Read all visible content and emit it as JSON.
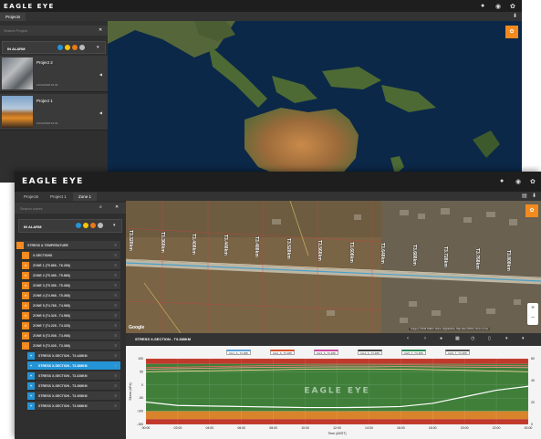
{
  "app": {
    "brand": "EAGLE EYE",
    "accent": "#f28a1e",
    "selected_color": "#2494d6"
  },
  "window1": {
    "tabs": [
      "Projects"
    ],
    "search_placeholder": "Search Project",
    "alarm_label": "IN ALARM",
    "alarm_badges": [
      {
        "color": "#2494d6"
      },
      {
        "color": "#f2c40c"
      },
      {
        "color": "#e8781c"
      },
      {
        "color": "#bbbbbb"
      }
    ],
    "projects": [
      {
        "name": "Project 2",
        "date": "10/12/2018 10:30"
      },
      {
        "name": "Project 1",
        "date": "10/12/2018 10:30"
      }
    ]
  },
  "window2": {
    "tabs": [
      "Projects",
      "Project 1",
      "Zone 1"
    ],
    "search_placeholder": "Search zones",
    "alarm_label": "IN ALARM",
    "tree": [
      {
        "label": "STRESS & TEMPERATURE",
        "level": 0,
        "icon": "-",
        "kind": "orange"
      },
      {
        "label": "X-SECTIONS",
        "level": 1,
        "icon": "-",
        "kind": "orange"
      },
      {
        "label": "ZONE 1 (T5.868 - T6.268)",
        "level": 2,
        "icon": ">",
        "kind": "orange"
      },
      {
        "label": "ZONE 2 (T5.368 - T5.868)",
        "level": 2,
        "icon": ">",
        "kind": "orange"
      },
      {
        "label": "ZONE 3 (T5.358 - T5.368)",
        "level": 2,
        "icon": ">",
        "kind": "orange"
      },
      {
        "label": "ZONE 4 (T4.968 - T5.368)",
        "level": 2,
        "icon": ">",
        "kind": "orange"
      },
      {
        "label": "ZONE 5 (T4.768 - T4.968)",
        "level": 2,
        "icon": ">",
        "kind": "orange"
      },
      {
        "label": "ZONE 6 (T4.328 - T4.568)",
        "level": 2,
        "icon": ">",
        "kind": "orange"
      },
      {
        "label": "ZONE 7 (T4.228 - T4.328)",
        "level": 2,
        "icon": ">",
        "kind": "orange"
      },
      {
        "label": "ZONE 8 (T3.008 - T4.068)",
        "level": 2,
        "icon": ">",
        "kind": "orange"
      },
      {
        "label": "ZONE 9 (T3.028 - T3.368)",
        "level": 2,
        "icon": "-",
        "kind": "orange"
      },
      {
        "label": "STRESS X-SECTION - T3.448KM",
        "level": 3,
        "icon": "+",
        "kind": "blue"
      },
      {
        "label": "STRESS X-SECTION - T3.388KM",
        "level": 3,
        "icon": "+",
        "kind": "blue",
        "selected": true
      },
      {
        "label": "STRESS X-SECTION - T3.328KM",
        "level": 3,
        "icon": "+",
        "kind": "blue"
      },
      {
        "label": "STRESS X-SECTION - T3.268KM",
        "level": 3,
        "icon": "+",
        "kind": "blue"
      },
      {
        "label": "STRESS X-SECTION - T3.208KM",
        "level": 3,
        "icon": "+",
        "kind": "blue"
      },
      {
        "label": "STRESS X-SECTION - T3.088KM",
        "level": 3,
        "icon": "+",
        "kind": "blue"
      }
    ],
    "map_labels": [
      "T3.328km",
      "T3.368km",
      "T3.408km",
      "T3.448km",
      "T3.488km",
      "T3.528km",
      "T3.568km",
      "T3.608km",
      "T3.648km",
      "T3.688km",
      "T3.728km",
      "T3.768km",
      "T3.808km"
    ],
    "map_footer": "Imagery ©2018 CNES / Airbus, DigitalGlobe, Map data ©2018 | Terms of Use",
    "google": "Google",
    "toolbar_title": "STRESS X-SECTION - T3.388KM"
  },
  "chart_data": {
    "type": "line",
    "watermark": "EAGLE EYE",
    "legend": [
      "CH1_S_T3.388",
      "CH2_S_T3.388",
      "CH3_S_T3.388",
      "CH4_S_T3.388",
      "CH5_T_T3.388",
      "CH6_T_T3.388"
    ],
    "legend_colors": [
      "#5aa0d8",
      "#d9532b",
      "#c94a9c",
      "#444444",
      "#2e8b57",
      "#555555"
    ],
    "ylabel": "Stress (kPa)",
    "xlabel": "Time (AEST)",
    "y_ticks": [
      100,
      50,
      0,
      -50,
      -100,
      -150
    ],
    "y2_ticks": [
      60,
      40,
      20,
      0
    ],
    "ylim": [
      -150,
      100
    ],
    "x_ticks": [
      "00:00",
      "02:00",
      "04:00",
      "06:00",
      "08:00",
      "10:00",
      "12:00",
      "14:00",
      "16:00",
      "18:00",
      "20:00",
      "22:00",
      "00:00"
    ],
    "series": [
      {
        "color": "#ff6666",
        "values": [
          66,
          68,
          70,
          72,
          74,
          75,
          76,
          76,
          77,
          76,
          75,
          74,
          73
        ]
      },
      {
        "color": "#ff9999",
        "values": [
          60,
          62,
          64,
          66,
          67,
          68,
          69,
          69,
          70,
          69,
          68,
          67,
          66
        ]
      },
      {
        "color": "#ffd9a0",
        "values": [
          50,
          52,
          54,
          56,
          58,
          60,
          61,
          61,
          60,
          58,
          56,
          53,
          50
        ]
      },
      {
        "color": "#ffffff",
        "values": [
          -65,
          -78,
          -80,
          -82,
          -84,
          -86,
          -86,
          -85,
          -82,
          -70,
          -45,
          -20,
          -5
        ]
      }
    ]
  },
  "colors": {
    "ok_band": "#3f7f3a",
    "alarm_band": "#c0392b",
    "warn_band": "#d9842b"
  }
}
